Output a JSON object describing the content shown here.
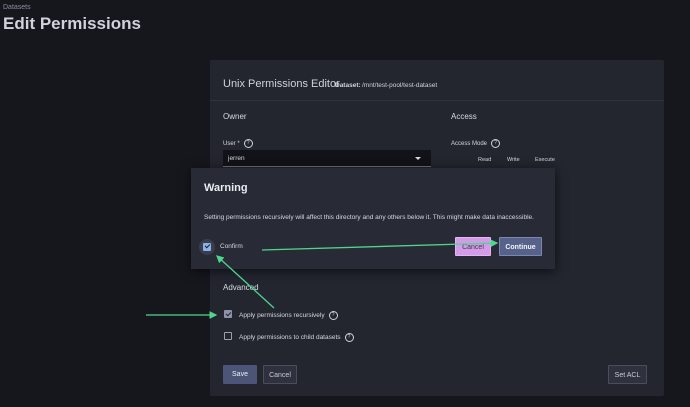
{
  "breadcrumb": "Datasets",
  "page_title": "Edit Permissions",
  "editor": {
    "title": "Unix Permissions Editor",
    "dataset_label": "Dataset:",
    "dataset_path": "/mnt/test-pool/test-dataset",
    "owner_title": "Owner",
    "user_label": "User *",
    "user_value": "jerren",
    "access_title": "Access",
    "access_mode_label": "Access Mode",
    "columns": [
      "Read",
      "Write",
      "Execute"
    ],
    "advanced_title": "Advanced",
    "apply_recursively": {
      "label": "Apply permissions recursively",
      "checked": true
    },
    "apply_child": {
      "label": "Apply permissions to child datasets",
      "checked": false
    },
    "save_label": "Save",
    "cancel_label": "Cancel",
    "set_acl_label": "Set ACL"
  },
  "dialog": {
    "title": "Warning",
    "message": "Setting permissions recursively will affect this directory and any others below it. This might make data inaccessible.",
    "confirm_label": "Confirm",
    "confirm_checked": true,
    "cancel_label": "Cancel",
    "continue_label": "Continue"
  },
  "colors": {
    "annotation_arrow": "#4fd58f",
    "accent": "#566289",
    "highlight": "#d49be8"
  },
  "icons": {
    "help": "help-circle-icon",
    "dropdown": "chevron-down-icon",
    "check": "checkmark-icon"
  }
}
